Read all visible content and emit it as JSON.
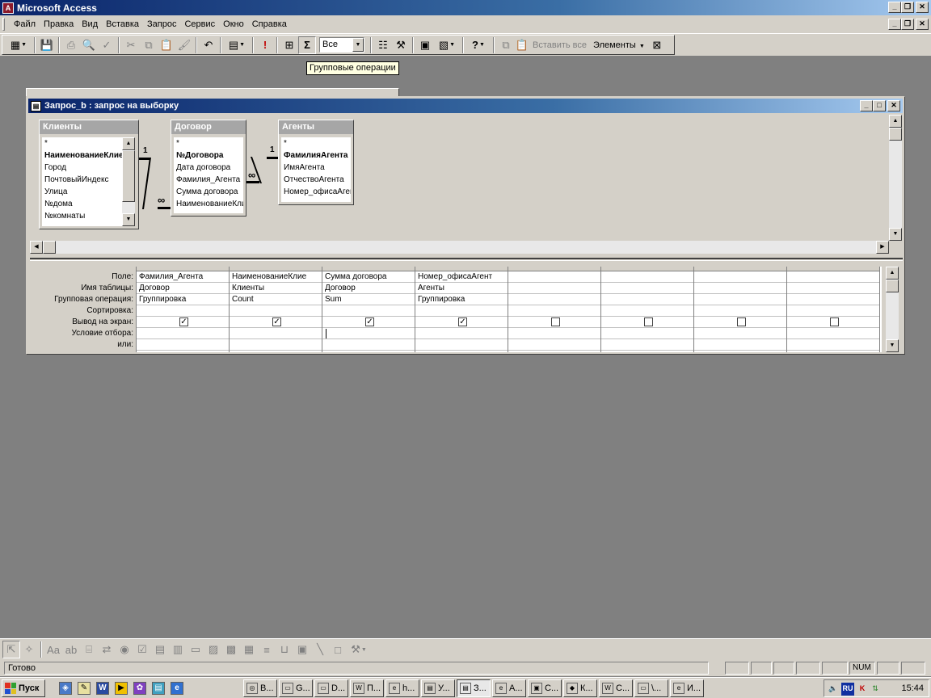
{
  "app": {
    "title": "Microsoft Access"
  },
  "menu": [
    "Файл",
    "Правка",
    "Вид",
    "Вставка",
    "Запрос",
    "Сервис",
    "Окно",
    "Справка"
  ],
  "toolbar": {
    "query_type_combo": "Все",
    "paste_all": "Вставить все",
    "elements_menu": "Элементы",
    "sigma_symbol": "Σ",
    "run_symbol": "!",
    "help_symbol": "?"
  },
  "tooltip": "Групповые операции",
  "query_window": {
    "title": "Запрос_b : запрос на выборку",
    "tables": [
      {
        "name": "Клиенты",
        "fields": [
          "*",
          "НаименованиеКлие",
          "Город",
          "ПочтовыйИндекс",
          "Улица",
          "№дома",
          "№комнаты"
        ],
        "key_index": 1
      },
      {
        "name": "Договор",
        "fields": [
          "*",
          "№Договора",
          "Дата договора",
          "Фамилия_Агента",
          "Сумма договора",
          "НаименованиеКлие"
        ],
        "key_index": 1
      },
      {
        "name": "Агенты",
        "fields": [
          "*",
          "ФамилияАгента",
          "ИмяАгента",
          "ОтчествоАгента",
          "Номер_офисаАгент"
        ],
        "key_index": 1
      }
    ],
    "relations": [
      {
        "one": "1",
        "many": "∞"
      },
      {
        "one": "1",
        "many": "∞"
      }
    ],
    "grid": {
      "row_labels": [
        "Поле:",
        "Имя таблицы:",
        "Групповая операция:",
        "Сортировка:",
        "Вывод на экран:",
        "Условие отбора:",
        "или:"
      ],
      "columns": [
        {
          "field": "Фамилия_Агента",
          "table": "Договор",
          "total": "Группировка",
          "sort": "",
          "show": true,
          "criteria": "",
          "or": ""
        },
        {
          "field": "НаименованиеКлие",
          "table": "Клиенты",
          "total": "Count",
          "sort": "",
          "show": true,
          "criteria": "",
          "or": ""
        },
        {
          "field": "Сумма договора",
          "table": "Договор",
          "total": "Sum",
          "sort": "",
          "show": true,
          "criteria": "",
          "or": ""
        },
        {
          "field": "Номер_офисаАгент",
          "table": "Агенты",
          "total": "Группировка",
          "sort": "",
          "show": true,
          "criteria": "",
          "or": ""
        },
        {
          "field": "",
          "table": "",
          "total": "",
          "sort": "",
          "show": false,
          "criteria": "",
          "or": ""
        },
        {
          "field": "",
          "table": "",
          "total": "",
          "sort": "",
          "show": false,
          "criteria": "",
          "or": ""
        },
        {
          "field": "",
          "table": "",
          "total": "",
          "sort": "",
          "show": false,
          "criteria": "",
          "or": ""
        },
        {
          "field": "",
          "table": "",
          "total": "",
          "sort": "",
          "show": false,
          "criteria": "",
          "or": ""
        }
      ]
    }
  },
  "status": {
    "text": "Готово",
    "num": "NUM"
  },
  "taskbar": {
    "start": "Пуск",
    "tasks": [
      "В...",
      "G...",
      "D...",
      "П...",
      "h...",
      "У...",
      "З...",
      "А...",
      "С...",
      "К...",
      "С...",
      "\\...",
      "И..."
    ],
    "clock": "15:44",
    "lang": "RU"
  },
  "colors": {
    "titlebar": "#0a246a",
    "face": "#d4d0c8",
    "desktop": "#808080",
    "tooltip": "#ffffe1"
  }
}
